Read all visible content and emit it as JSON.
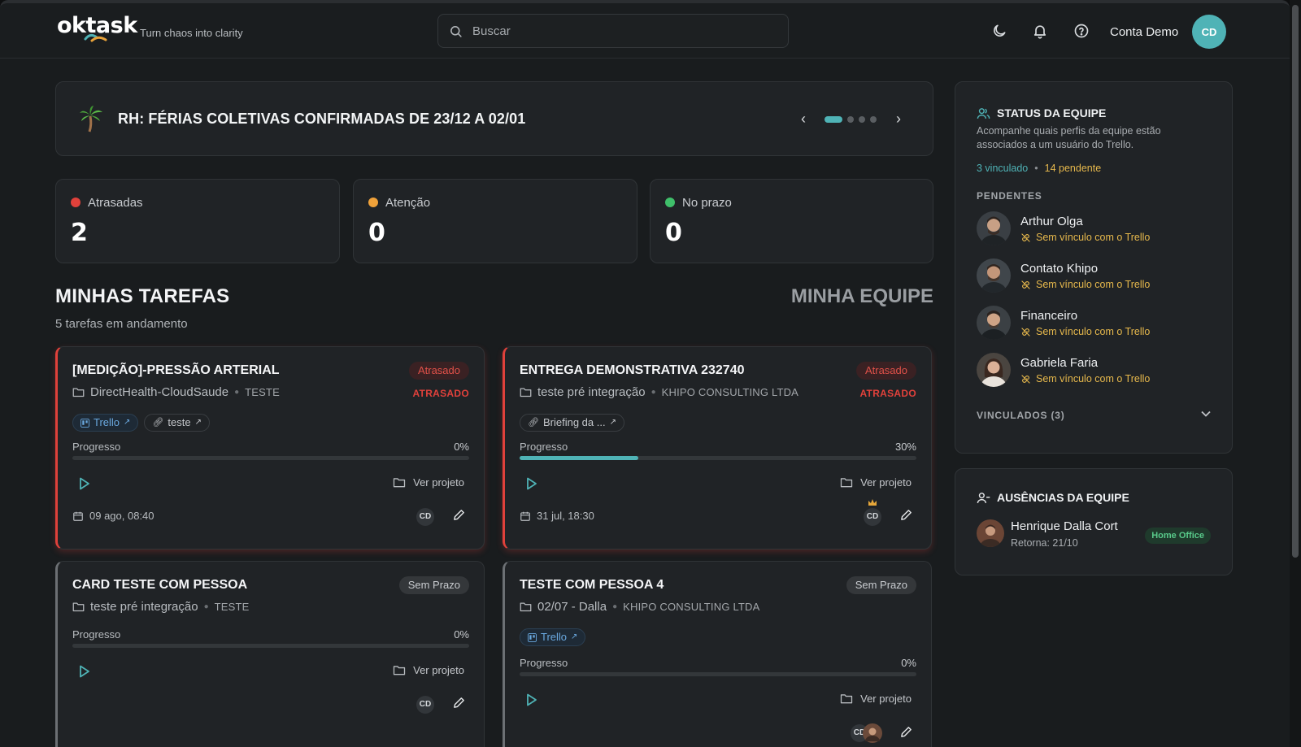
{
  "header": {
    "logo": "oktask",
    "tagline": "Turn chaos into clarity",
    "search_placeholder": "Buscar",
    "account_name": "Conta Demo",
    "account_initials": "CD",
    "icons": [
      "moon-icon",
      "bell-icon",
      "help-icon"
    ]
  },
  "banner": {
    "text": "RH: FÉRIAS COLETIVAS CONFIRMADAS DE 23/12 A 02/01",
    "slide_count": 4,
    "active_slide": 1
  },
  "stats": [
    {
      "label": "Atrasadas",
      "value": "2",
      "color": "#e0413b"
    },
    {
      "label": "Atenção",
      "value": "0",
      "color": "#f0a23a"
    },
    {
      "label": "No prazo",
      "value": "0",
      "color": "#3fbf6a"
    }
  ],
  "tasks_section": {
    "title": "MINHAS TAREFAS",
    "subtitle": "5 tarefas em andamento",
    "team_tab": "MINHA EQUIPE"
  },
  "tasks": [
    {
      "title": "[MEDIÇÃO]-PRESSÃO ARTERIAL",
      "badge": "Atrasado",
      "late_label": "ATRASADO",
      "project": "DirectHealth-CloudSaude",
      "client": "TESTE",
      "chips": [
        "Trello",
        "teste"
      ],
      "progress_label": "Progresso",
      "progress_text": "0%",
      "progress": 0,
      "view_label": "Ver projeto",
      "date": "09 ago, 08:40",
      "assignee": "CD"
    },
    {
      "title": "ENTREGA DEMONSTRATIVA 232740",
      "badge": "Atrasado",
      "late_label": "ATRASADO",
      "project": "teste pré integração",
      "client": "KHIPO CONSULTING LTDA",
      "chips": [
        "Briefing da ..."
      ],
      "progress_label": "Progresso",
      "progress_text": "30%",
      "progress": 30,
      "view_label": "Ver projeto",
      "date": "31 jul, 18:30",
      "assignee": "CD"
    },
    {
      "title": "CARD TESTE COM PESSOA",
      "badge": "Sem Prazo",
      "project": "teste pré integração",
      "client": "TESTE",
      "progress_label": "Progresso",
      "progress_text": "0%",
      "progress": 0,
      "view_label": "Ver projeto",
      "assignee": "CD"
    },
    {
      "title": "TESTE COM PESSOA 4",
      "badge": "Sem Prazo",
      "project": "02/07 - Dalla",
      "client": "KHIPO CONSULTING LTDA",
      "chips": [
        "Trello"
      ],
      "progress_label": "Progresso",
      "progress_text": "0%",
      "progress": 0,
      "view_label": "Ver projeto",
      "assignee": "CD"
    }
  ],
  "team_status": {
    "title": "STATUS DA EQUIPE",
    "description": "Acompanhe quais perfis da equipe estão associados a um usuário do Trello.",
    "linked": "3 vinculado",
    "pending": "14 pendente",
    "pending_heading": "PENDENTES",
    "members": [
      {
        "name": "Arthur Olga",
        "status": "Sem vínculo com o Trello"
      },
      {
        "name": "Contato Khipo",
        "status": "Sem vínculo com o Trello"
      },
      {
        "name": "Financeiro",
        "status": "Sem vínculo com o Trello"
      },
      {
        "name": "Gabriela Faria",
        "status": "Sem vínculo com o Trello"
      }
    ],
    "linked_heading": "VINCULADOS (3)"
  },
  "absences": {
    "title": "AUSÊNCIAS DA EQUIPE",
    "person": "Henrique Dalla Cort",
    "returns": "Retorna: 21/10",
    "badge": "Home Office"
  }
}
